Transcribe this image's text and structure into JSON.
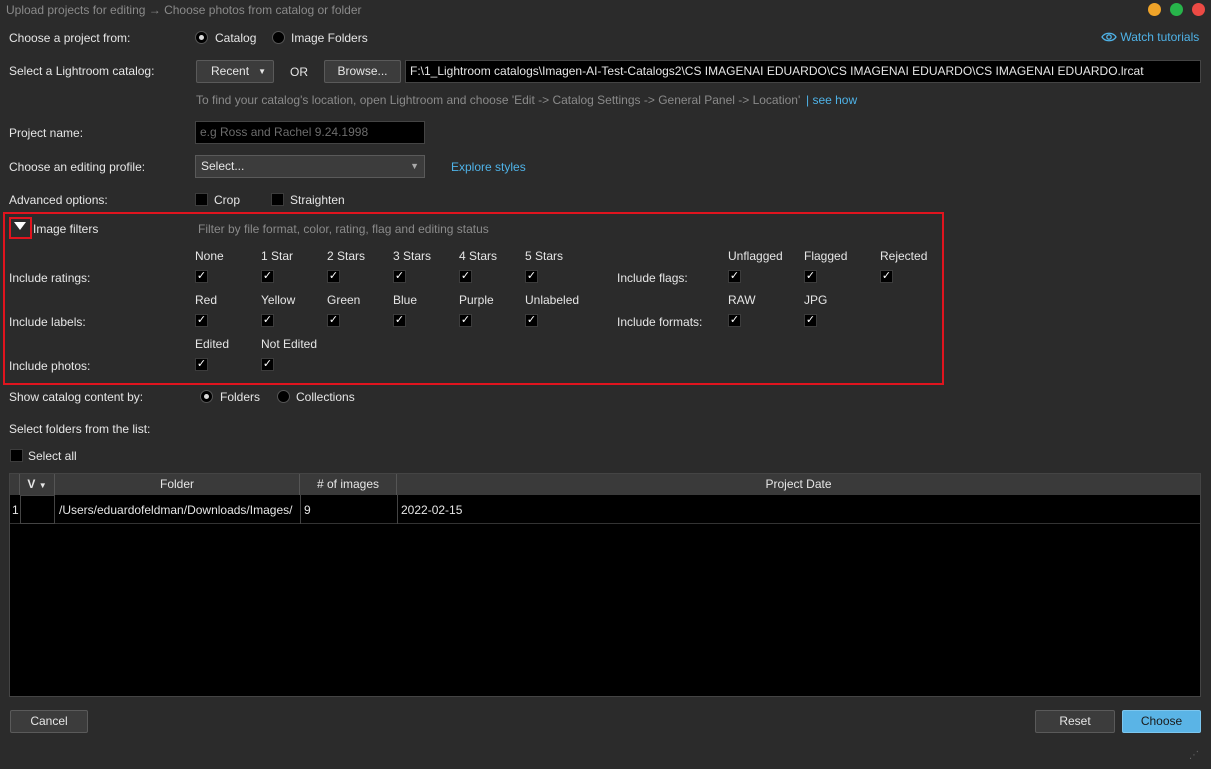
{
  "window": {
    "title": "Upload projects for editing → Choose photos from catalog or folder",
    "controls": {
      "minimize": "#f0a429",
      "maximize": "#27b44a",
      "close": "#ec4a44"
    }
  },
  "choose_from": {
    "label": "Choose a project from:",
    "options": [
      "Catalog",
      "Image Folders"
    ],
    "selected": "Catalog"
  },
  "watch_tutorials": "Watch tutorials",
  "catalog": {
    "label": "Select a Lightroom catalog:",
    "recent": "Recent",
    "or": "OR",
    "browse": "Browse...",
    "path": "F:\\1_Lightroom catalogs\\Imagen-AI-Test-Catalogs2\\CS IMAGENAI EDUARDO\\CS IMAGENAI EDUARDO\\CS IMAGENAI EDUARDO.lrcat",
    "hint": "To find your catalog's location, open Lightroom and choose 'Edit -> Catalog Settings -> General Panel -> Location'",
    "see_how": "| see how"
  },
  "project_name": {
    "label": "Project name:",
    "placeholder": "e.g Ross and Rachel 9.24.1998"
  },
  "editing_profile": {
    "label": "Choose an editing profile:",
    "value": "Select...",
    "explore": "Explore styles"
  },
  "advanced": {
    "label": "Advanced options:",
    "crop": "Crop",
    "straighten": "Straighten"
  },
  "filters": {
    "title": "Image filters",
    "hint": "Filter by file format, color, rating, flag and editing status",
    "ratings": {
      "label": "Include ratings:",
      "options": [
        "None",
        "1 Star",
        "2 Stars",
        "3 Stars",
        "4 Stars",
        "5 Stars"
      ]
    },
    "labels": {
      "label": "Include labels:",
      "options": [
        "Red",
        "Yellow",
        "Green",
        "Blue",
        "Purple",
        "Unlabeled"
      ]
    },
    "photos": {
      "label": "Include photos:",
      "options": [
        "Edited",
        "Not Edited"
      ]
    },
    "flags": {
      "label": "Include flags:",
      "options": [
        "Unflagged",
        "Flagged",
        "Rejected"
      ]
    },
    "formats": {
      "label": "Include formats:",
      "options": [
        "RAW",
        "JPG"
      ]
    },
    "check_mark": "✓"
  },
  "show_by": {
    "label": "Show catalog content by:",
    "options": [
      "Folders",
      "Collections"
    ],
    "selected": "Folders"
  },
  "select_folders_label": "Select folders from the list:",
  "select_all": "Select all",
  "table": {
    "columns": [
      "V",
      "Folder",
      "# of images",
      "Project Date"
    ],
    "rows": [
      {
        "index": "1",
        "folder": "/Users/eduardofeldman/Downloads/Images/",
        "count": "9",
        "date": "2022-02-15"
      }
    ]
  },
  "buttons": {
    "cancel": "Cancel",
    "reset": "Reset",
    "choose": "Choose"
  },
  "colors": {
    "accent": "#4fb3e8",
    "highlight": "#e0141e",
    "choose_bg": "#5ab4e6"
  }
}
